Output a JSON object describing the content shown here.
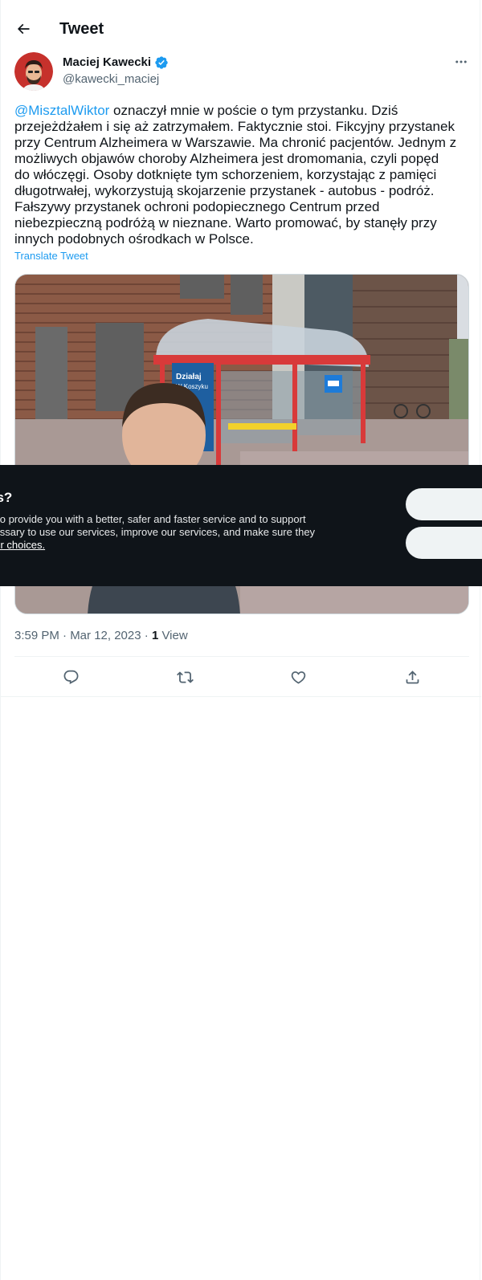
{
  "header": {
    "title": "Tweet",
    "back_icon": "arrow-left-icon"
  },
  "tweet": {
    "author": {
      "name": "Maciej Kawecki",
      "handle": "@kawecki_maciej",
      "verified": true
    },
    "text_mention": "@MisztalWiktor",
    "text_lines": [
      " oznaczył mnie w poście o tym przystanku. Dziś",
      "przejeżdżałem i się aż zatrzymałem. Faktycznie stoi. Fikcyjny przystanek",
      "przy Centrum Alzheimera w Warszawie. Ma chronić pacjentów. Jednym z",
      "możliwych objawów choroby Alzheimera jest dromomania, czyli popęd",
      "do włóczęgi. Osoby dotknięte tym schorzeniem, korzystając z pamięci",
      "długotrwałej, wykorzystują skojarzenie przystanek - autobus - podróż.",
      "Fałszywy przystanek ochroni podopiecznego Centrum przed",
      "niebezpieczną podróżą w nieznane. Warto promować, by stanęły przy",
      "innych podobnych ośrodkach w Polsce."
    ],
    "translate_label": "Translate Tweet",
    "media": {
      "sign_text": "Działaj",
      "sign_text_2": "W Koszyku"
    },
    "timestamp": "3:59 PM · Mar 12, 2023",
    "separator": " · ",
    "views_count": "1",
    "views_label": "View"
  },
  "actions": [
    {
      "name": "reply-icon"
    },
    {
      "name": "retweet-icon"
    },
    {
      "name": "like-icon"
    },
    {
      "name": "share-icon"
    }
  ],
  "cookie_banner": {
    "title": "es?",
    "lines": [
      "s to provide you with a better, safer and faster service and to support",
      "cessary to use our services, improve our services, and make sure they"
    ],
    "link_text": "our choices.",
    "accept_label": "",
    "refuse_label": ""
  },
  "colors": {
    "accent": "#1d9bf0",
    "text": "#0f1419",
    "secondary": "#536471",
    "banner": "#0f1419"
  }
}
